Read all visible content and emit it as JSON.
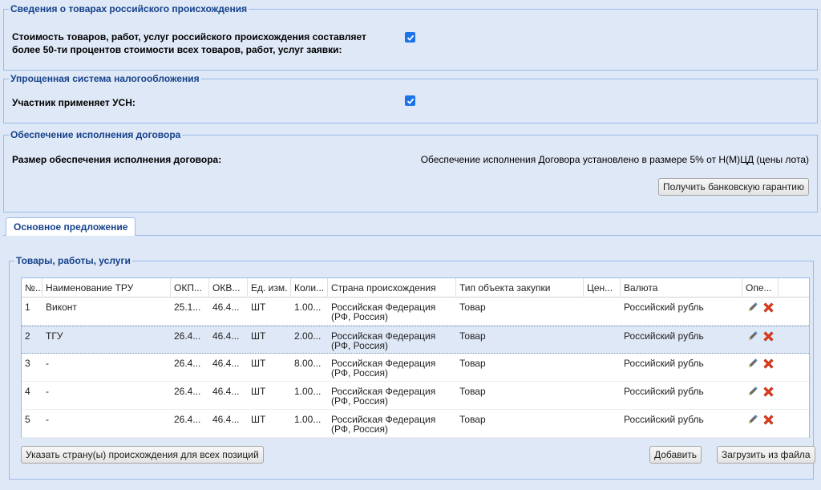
{
  "russian_goods": {
    "legend": "Сведения о товарах российского происхождения",
    "label": "Стоимость товаров, работ, услуг российского происхождения составляет более 50-ти процентов стоимости всех товаров, работ, услуг заявки:",
    "checked": true
  },
  "tax_system": {
    "legend": "Упрощенная система налогообложения",
    "label": "Участник применяет УСН:",
    "checked": true
  },
  "security": {
    "legend": "Обеспечение исполнения договора",
    "label": "Размер обеспечения исполнения договора:",
    "value": "Обеспечение исполнения Договора установлено в размере 5% от Н(М)ЦД (цены лота)",
    "bank_guarantee_button": "Получить банковскую гарантию"
  },
  "tabs": [
    {
      "label": "Основное предложение",
      "active": true
    }
  ],
  "goods": {
    "legend": "Товары, работы, услуги",
    "columns": [
      "№...",
      "Наименование ТРУ",
      "ОКП...",
      "ОКВ...",
      "Ед. изм.",
      "Коли...",
      "Страна происхождения",
      "Тип объекта закупки",
      "Цен...",
      "Валюта",
      "Опе..."
    ],
    "rows": [
      [
        "1",
        "Виконт",
        "25.1...",
        "46.4...",
        "ШТ",
        "1.00...",
        "Российская Федерация (РФ, Россия)",
        "Товар",
        "",
        "Российский рубль"
      ],
      [
        "2",
        "ТГУ",
        "26.4...",
        "46.4...",
        "ШТ",
        "2.00...",
        "Российская Федерация (РФ, Россия)",
        "Товар",
        "",
        "Российский рубль"
      ],
      [
        "3",
        "-",
        "26.4...",
        "46.4...",
        "ШТ",
        "8.00...",
        "Российская Федерация (РФ, Россия)",
        "Товар",
        "",
        "Российский рубль"
      ],
      [
        "4",
        "-",
        "26.4...",
        "46.4...",
        "ШТ",
        "1.00...",
        "Российская Федерация (РФ, Россия)",
        "Товар",
        "",
        "Российский рубль"
      ],
      [
        "5",
        "-",
        "26.4...",
        "46.4...",
        "ШТ",
        "1.00...",
        "Российская Федерация (РФ, Россия)",
        "Товар",
        "",
        "Российский рубль"
      ]
    ],
    "selected_row": 2,
    "row_icons": [
      "pencil-icon",
      "delete-x-icon"
    ],
    "set_country_button": "Указать страну(ы) происхождения для всех позиций",
    "add_button": "Добавить",
    "upload_button": "Загрузить из файла"
  },
  "colors": {
    "legend": "#15428b",
    "border": "#99bbe8",
    "background": "#dfe8f6",
    "checkbox": "#1a73e8",
    "delete": "#e53a1c"
  }
}
